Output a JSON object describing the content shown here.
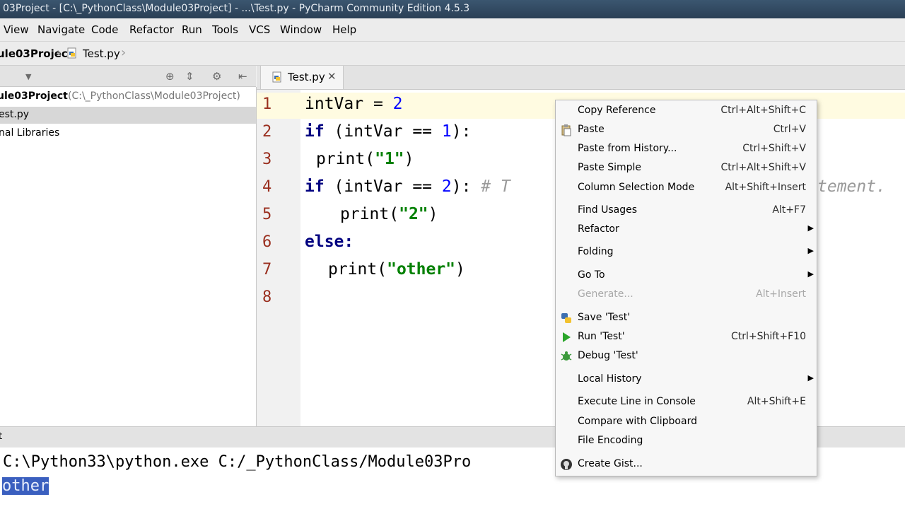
{
  "window": {
    "title": "03Project - [C:\\_PythonClass\\Module03Project] - ...\\Test.py - PyCharm Community Edition 4.5.3"
  },
  "menu": [
    "View",
    "Navigate",
    "Code",
    "Refactor",
    "Run",
    "Tools",
    "VCS",
    "Window",
    "Help"
  ],
  "breadcrumb": {
    "project": "ule03Project",
    "file": "Test.py"
  },
  "project_tree": {
    "root_label": "ule03Project",
    "root_path": "(C:\\_PythonClass\\Module03Project)",
    "file": "est.py",
    "libraries": "nal Libraries"
  },
  "editor": {
    "tab_label": "Test.py",
    "line_numbers": [
      "1",
      "2",
      "3",
      "4",
      "5",
      "6",
      "7",
      "8"
    ],
    "lines": [
      {
        "l1_a": "intVar",
        "l1_b": " = ",
        "l1_c": "2"
      },
      {
        "kw": "if",
        "a": " (intVar == ",
        "n": "1",
        "b": "):"
      },
      {
        "a": "print(",
        "s": "\"1\"",
        "b": ")"
      },
      {
        "kw": "if",
        "a": " (intVar == ",
        "n": "2",
        "b": "):",
        "comment": "# T",
        "comment_tail": "tement."
      },
      {
        "a": "print(",
        "s": "\"2\"",
        "b": ")"
      },
      {
        "kw": "else:"
      },
      {
        "a": "print(",
        "s": "\"other\"",
        "b": ")"
      }
    ]
  },
  "console": {
    "command": "C:\\Python33\\python.exe C:/_PythonClass/Module03Pro",
    "output": "other",
    "strip_label": "t"
  },
  "context_menu": {
    "items": [
      {
        "label": "Copy Reference",
        "shortcut": "Ctrl+Alt+Shift+C"
      },
      {
        "label": "Paste",
        "shortcut": "Ctrl+V",
        "icon": "clipboard-icon"
      },
      {
        "label": "Paste from History...",
        "shortcut": "Ctrl+Shift+V"
      },
      {
        "label": "Paste Simple",
        "shortcut": "Ctrl+Alt+Shift+V"
      },
      {
        "label": "Column Selection Mode",
        "shortcut": "Alt+Shift+Insert"
      },
      {
        "label": "Find Usages",
        "shortcut": "Alt+F7"
      },
      {
        "label": "Refactor",
        "submenu": true
      },
      {
        "label": "Folding",
        "submenu": true
      },
      {
        "label": "Go To",
        "submenu": true
      },
      {
        "label": "Generate...",
        "shortcut": "Alt+Insert",
        "disabled": true
      },
      {
        "label": "Save 'Test'",
        "icon": "python-icon"
      },
      {
        "label": "Run 'Test'",
        "shortcut": "Ctrl+Shift+F10",
        "icon": "run-icon"
      },
      {
        "label": "Debug 'Test'",
        "icon": "debug-icon"
      },
      {
        "label": "Local History",
        "submenu": true
      },
      {
        "label": "Execute Line in Console",
        "shortcut": "Alt+Shift+E"
      },
      {
        "label": "Compare with Clipboard"
      },
      {
        "label": "File Encoding"
      },
      {
        "label": "Create Gist...",
        "icon": "github-icon"
      }
    ]
  },
  "colors": {
    "accent_selection": "#3a5fbf",
    "line_number": "#9a2f1f",
    "keyword": "#000080",
    "string": "#008000",
    "number": "#0000ff"
  }
}
